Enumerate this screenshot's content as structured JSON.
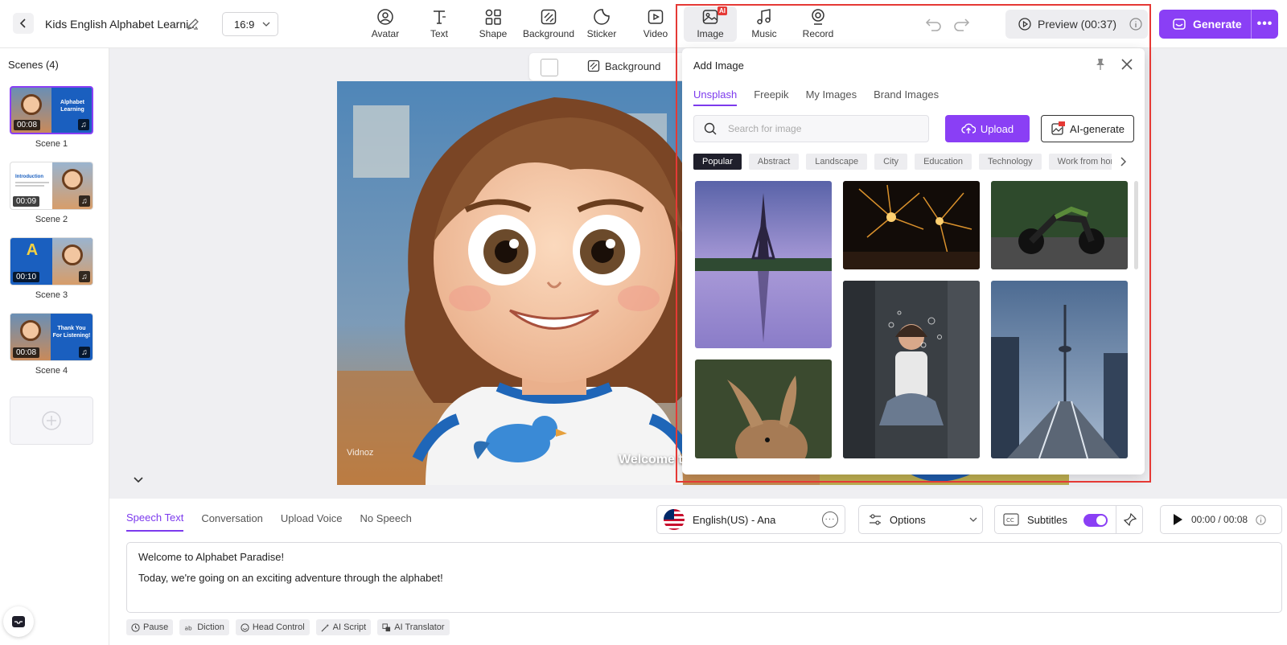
{
  "header": {
    "project_title": "Kids English Alphabet Learni...",
    "aspect_ratio": "16:9",
    "tools": [
      {
        "id": "avatar",
        "label": "Avatar",
        "icon": "avatar-icon"
      },
      {
        "id": "text",
        "label": "Text",
        "icon": "text-icon"
      },
      {
        "id": "shape",
        "label": "Shape",
        "icon": "shape-icon"
      },
      {
        "id": "background",
        "label": "Background",
        "icon": "background-icon"
      },
      {
        "id": "sticker",
        "label": "Sticker",
        "icon": "sticker-icon"
      },
      {
        "id": "video",
        "label": "Video",
        "icon": "video-icon"
      },
      {
        "id": "image",
        "label": "Image",
        "icon": "image-icon",
        "badge": "AI"
      },
      {
        "id": "music",
        "label": "Music",
        "icon": "music-icon"
      },
      {
        "id": "record",
        "label": "Record",
        "icon": "record-icon"
      }
    ],
    "preview_label": "Preview (00:37)",
    "generate_label": "Generate",
    "more_label": "•••"
  },
  "sidebar": {
    "title": "Scenes (4)",
    "scenes": [
      {
        "label": "Scene 1",
        "duration": "00:08",
        "thumb_text": "Alphabet Learning",
        "bg": "#1a5fbf"
      },
      {
        "label": "Scene 2",
        "duration": "00:09",
        "thumb_text": "Introduction",
        "bg": "#ffffff"
      },
      {
        "label": "Scene 3",
        "duration": "00:10",
        "thumb_text": "A",
        "bg": "#1a5fbf"
      },
      {
        "label": "Scene 4",
        "duration": "00:08",
        "thumb_text": "Thank You For Listening!",
        "bg": "#1a5fbf"
      }
    ]
  },
  "canvas": {
    "background_label": "Background",
    "caption": "Welcome to",
    "watermark": "Vidnoz"
  },
  "image_panel": {
    "title": "Add Image",
    "tabs": [
      "Unsplash",
      "Freepik",
      "My Images",
      "Brand Images"
    ],
    "active_tab": "Unsplash",
    "search_placeholder": "Search for image",
    "upload_label": "Upload",
    "ai_generate_label": "AI-generate",
    "categories": [
      "Popular",
      "Abstract",
      "Landscape",
      "City",
      "Education",
      "Technology",
      "Work from home"
    ],
    "active_category": "Popular"
  },
  "speech": {
    "tabs": [
      "Speech Text",
      "Conversation",
      "Upload Voice",
      "No Speech"
    ],
    "active_tab": "Speech Text",
    "voice": "English(US) - Ana",
    "options_label": "Options",
    "subtitles_label": "Subtitles",
    "subtitles_on": true,
    "time": "00:00 / 00:08",
    "lines": [
      "Welcome to Alphabet Paradise!",
      "Today, we're going on an exciting adventure through the alphabet!"
    ],
    "tools": [
      {
        "label": "Pause",
        "icon": "clock-icon"
      },
      {
        "label": "Diction",
        "icon": "diction-icon"
      },
      {
        "label": "Head Control",
        "icon": "smile-icon"
      },
      {
        "label": "AI Script",
        "icon": "wand-icon"
      },
      {
        "label": "AI Translator",
        "icon": "translate-icon"
      }
    ]
  },
  "colors": {
    "accent": "#8a3ff5",
    "highlight": "#e53935"
  }
}
